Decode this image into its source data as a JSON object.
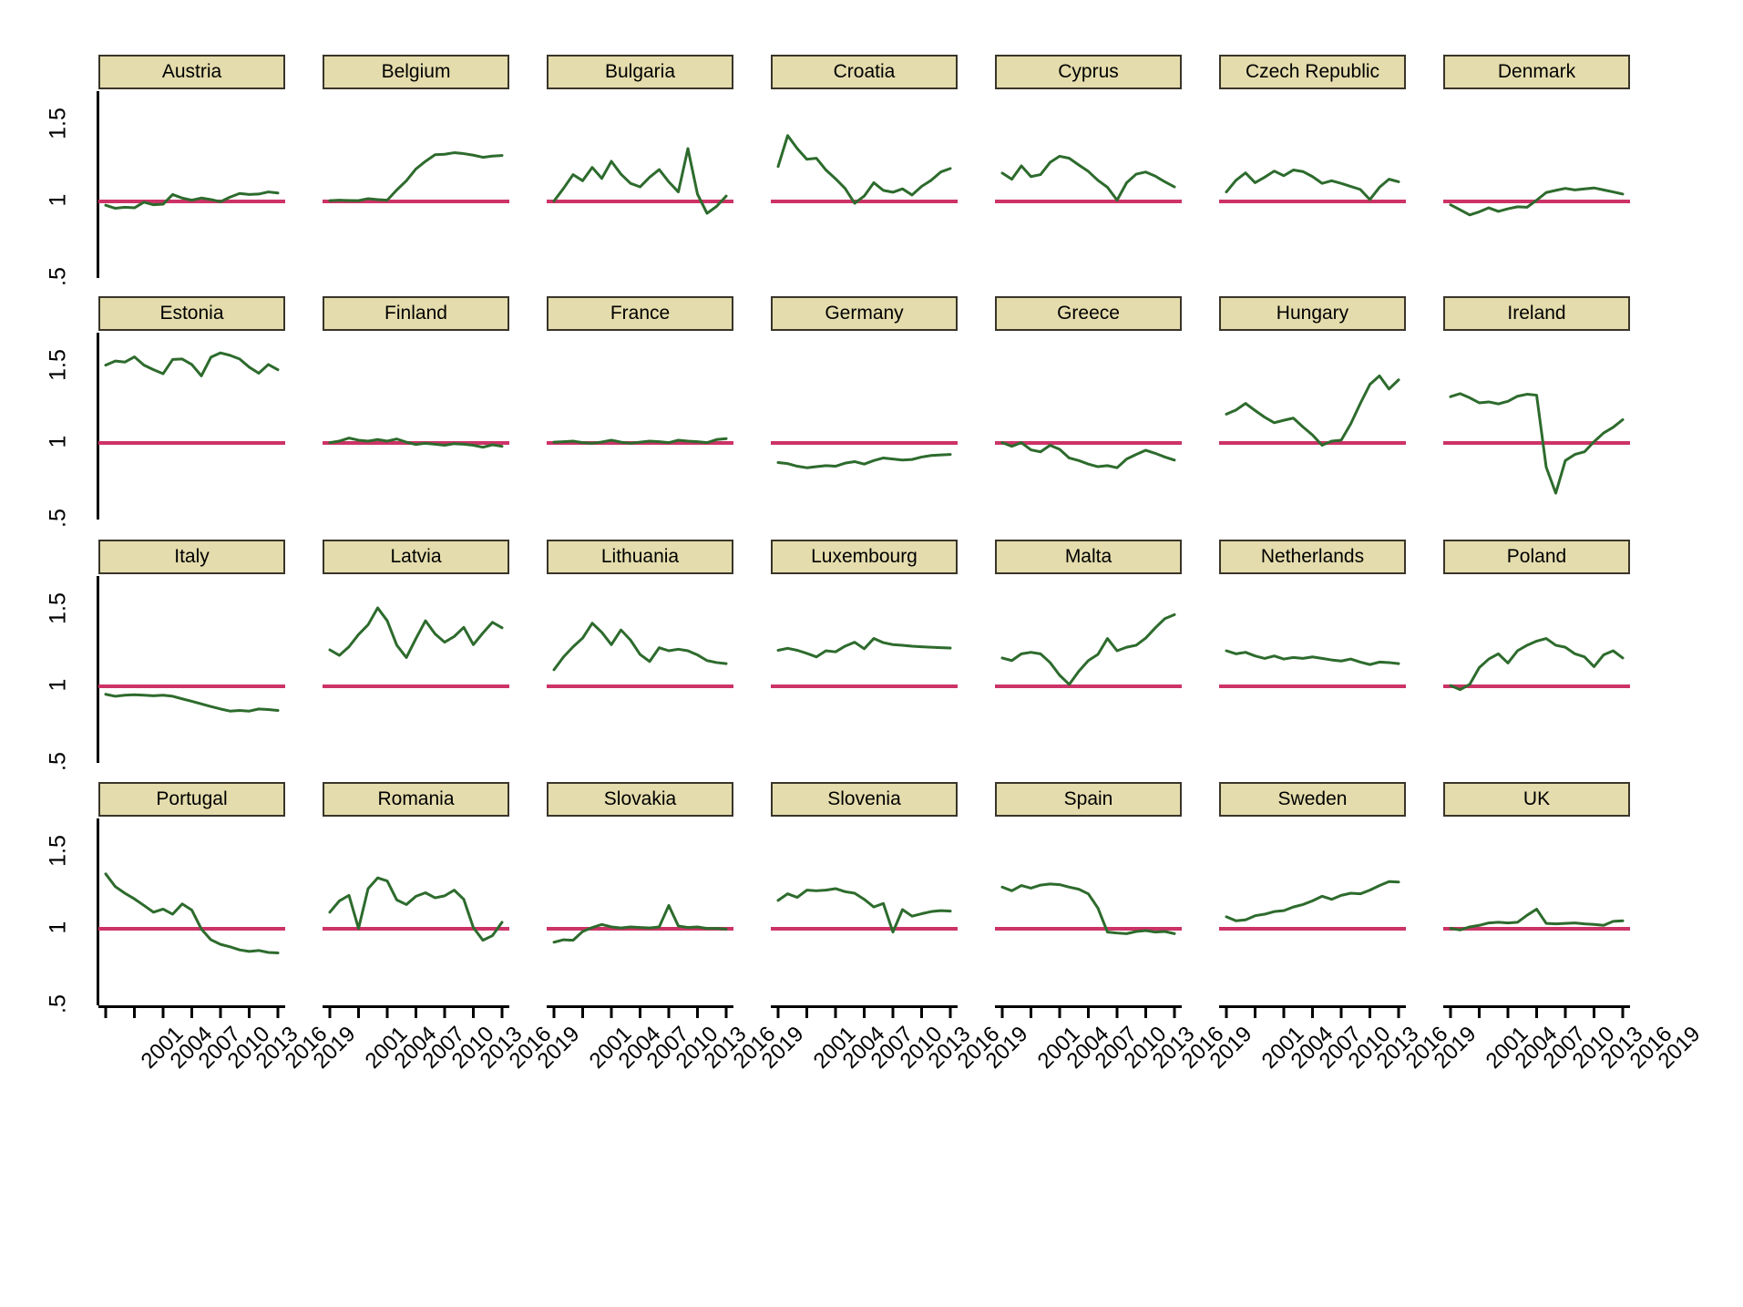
{
  "chart_data": {
    "type": "line",
    "title": "",
    "subtitle": "",
    "xlabel": "",
    "ylabel": "",
    "grid": false,
    "legend_position": "none",
    "layout": {
      "rows": 4,
      "cols": 7,
      "panels": 28
    },
    "x": [
      2001,
      2002,
      2003,
      2004,
      2005,
      2006,
      2007,
      2008,
      2009,
      2010,
      2011,
      2012,
      2013,
      2014,
      2015,
      2016,
      2017,
      2018,
      2019
    ],
    "xlim": [
      2001,
      2019
    ],
    "ylim": [
      0.5,
      1.72
    ],
    "xticks": [
      2001,
      2004,
      2007,
      2010,
      2013,
      2016,
      2019
    ],
    "xtick_labels": [
      "2001",
      "2004",
      "2007",
      "2010",
      "2013",
      "2016",
      "2019"
    ],
    "yticks": [
      0.5,
      1.0,
      1.5
    ],
    "ytick_labels": [
      ".5",
      "1",
      "1.5"
    ],
    "reference_line": {
      "value": 1.0,
      "color": "#cc3366",
      "width": 4
    },
    "series_color": "#2d6b2d",
    "series_width": 3,
    "panels": [
      {
        "name": "Austria",
        "row": 0,
        "col": 0,
        "values": [
          0.975,
          0.955,
          0.962,
          0.958,
          0.995,
          0.978,
          0.982,
          1.045,
          1.022,
          1.008,
          1.022,
          1.012,
          0.998,
          1.028,
          1.052,
          1.045,
          1.048,
          1.062,
          1.055
        ]
      },
      {
        "name": "Belgium",
        "row": 0,
        "col": 1,
        "values": [
          1.005,
          1.008,
          1.006,
          1.005,
          1.018,
          1.012,
          1.008,
          1.075,
          1.135,
          1.212,
          1.262,
          1.305,
          1.308,
          1.318,
          1.312,
          1.302,
          1.288,
          1.296,
          1.3
        ]
      },
      {
        "name": "Bulgaria",
        "row": 0,
        "col": 2,
        "values": [
          1.002,
          1.085,
          1.175,
          1.135,
          1.222,
          1.15,
          1.262,
          1.178,
          1.118,
          1.095,
          1.158,
          1.208,
          1.128,
          1.062,
          1.345,
          1.048,
          0.922,
          0.968,
          1.035
        ]
      },
      {
        "name": "Croatia",
        "row": 0,
        "col": 3,
        "values": [
          1.228,
          1.43,
          1.345,
          1.275,
          1.282,
          1.205,
          1.148,
          1.085,
          0.988,
          1.035,
          1.122,
          1.072,
          1.06,
          1.082,
          1.042,
          1.098,
          1.138,
          1.192,
          1.215
        ]
      },
      {
        "name": "Cyprus",
        "row": 0,
        "col": 4,
        "values": [
          1.185,
          1.145,
          1.232,
          1.162,
          1.175,
          1.255,
          1.295,
          1.282,
          1.238,
          1.196,
          1.138,
          1.092,
          1.008,
          1.122,
          1.178,
          1.192,
          1.165,
          1.128,
          1.095
        ]
      },
      {
        "name": "Czech Republic",
        "row": 0,
        "col": 5,
        "values": [
          1.062,
          1.138,
          1.186,
          1.122,
          1.158,
          1.198,
          1.168,
          1.205,
          1.195,
          1.162,
          1.118,
          1.135,
          1.118,
          1.098,
          1.078,
          1.012,
          1.092,
          1.145,
          1.128
        ]
      },
      {
        "name": "Denmark",
        "row": 0,
        "col": 6,
        "values": [
          0.978,
          0.945,
          0.912,
          0.932,
          0.958,
          0.935,
          0.952,
          0.965,
          0.962,
          1.008,
          1.058,
          1.072,
          1.085,
          1.075,
          1.082,
          1.088,
          1.075,
          1.062,
          1.048
        ]
      },
      {
        "name": "Estonia",
        "row": 1,
        "col": 0,
        "values": [
          1.508,
          1.535,
          1.528,
          1.562,
          1.508,
          1.478,
          1.452,
          1.545,
          1.548,
          1.512,
          1.438,
          1.56,
          1.588,
          1.572,
          1.548,
          1.495,
          1.455,
          1.512,
          1.478
        ]
      },
      {
        "name": "Finland",
        "row": 1,
        "col": 1,
        "values": [
          1.002,
          1.012,
          1.032,
          1.018,
          1.012,
          1.022,
          1.012,
          1.026,
          1.005,
          0.99,
          0.998,
          0.992,
          0.985,
          0.995,
          0.992,
          0.985,
          0.972,
          0.988,
          0.978
        ]
      },
      {
        "name": "France",
        "row": 1,
        "col": 2,
        "values": [
          1.005,
          1.008,
          1.012,
          1.002,
          0.998,
          1.006,
          1.018,
          1.005,
          0.998,
          1.005,
          1.012,
          1.008,
          1.002,
          1.018,
          1.012,
          1.008,
          1.002,
          1.022,
          1.028
        ]
      },
      {
        "name": "Germany",
        "row": 1,
        "col": 3,
        "values": [
          0.872,
          0.865,
          0.848,
          0.838,
          0.845,
          0.852,
          0.848,
          0.868,
          0.878,
          0.862,
          0.885,
          0.902,
          0.895,
          0.888,
          0.892,
          0.908,
          0.918,
          0.922,
          0.925
        ]
      },
      {
        "name": "Greece",
        "row": 1,
        "col": 4,
        "values": [
          1.002,
          0.978,
          1.002,
          0.955,
          0.942,
          0.985,
          0.958,
          0.902,
          0.885,
          0.862,
          0.845,
          0.852,
          0.838,
          0.895,
          0.925,
          0.952,
          0.932,
          0.908,
          0.888
        ]
      },
      {
        "name": "Hungary",
        "row": 1,
        "col": 5,
        "values": [
          1.188,
          1.215,
          1.258,
          1.212,
          1.168,
          1.132,
          1.148,
          1.162,
          1.105,
          1.052,
          0.985,
          1.012,
          1.018,
          1.125,
          1.258,
          1.382,
          1.438,
          1.352,
          1.412
        ]
      },
      {
        "name": "Ireland",
        "row": 1,
        "col": 6,
        "values": [
          1.302,
          1.322,
          1.295,
          1.262,
          1.268,
          1.255,
          1.272,
          1.305,
          1.318,
          1.312,
          0.842,
          0.672,
          0.885,
          0.925,
          0.942,
          1.008,
          1.065,
          1.102,
          1.152
        ]
      },
      {
        "name": "Italy",
        "row": 2,
        "col": 0,
        "values": [
          0.948,
          0.935,
          0.942,
          0.945,
          0.942,
          0.938,
          0.942,
          0.935,
          0.918,
          0.902,
          0.885,
          0.868,
          0.852,
          0.838,
          0.842,
          0.838,
          0.852,
          0.848,
          0.842
        ]
      },
      {
        "name": "Latvia",
        "row": 2,
        "col": 1,
        "values": [
          1.238,
          1.202,
          1.258,
          1.338,
          1.402,
          1.512,
          1.428,
          1.268,
          1.188,
          1.312,
          1.428,
          1.342,
          1.288,
          1.325,
          1.385,
          1.272,
          1.348,
          1.418,
          1.382
        ]
      },
      {
        "name": "Lithuania",
        "row": 2,
        "col": 2,
        "values": [
          1.108,
          1.192,
          1.258,
          1.315,
          1.412,
          1.352,
          1.272,
          1.368,
          1.302,
          1.208,
          1.162,
          1.252,
          1.232,
          1.242,
          1.232,
          1.205,
          1.168,
          1.155,
          1.148
        ]
      },
      {
        "name": "Luxembourg",
        "row": 2,
        "col": 3,
        "values": [
          1.235,
          1.248,
          1.235,
          1.215,
          1.192,
          1.232,
          1.225,
          1.262,
          1.288,
          1.245,
          1.312,
          1.285,
          1.272,
          1.268,
          1.262,
          1.258,
          1.255,
          1.252,
          1.25
        ]
      },
      {
        "name": "Malta",
        "row": 2,
        "col": 4,
        "values": [
          1.185,
          1.168,
          1.212,
          1.222,
          1.212,
          1.155,
          1.072,
          1.012,
          1.098,
          1.168,
          1.208,
          1.312,
          1.232,
          1.255,
          1.268,
          1.315,
          1.382,
          1.442,
          1.468
        ]
      },
      {
        "name": "Netherlands",
        "row": 2,
        "col": 5,
        "values": [
          1.232,
          1.212,
          1.222,
          1.198,
          1.182,
          1.198,
          1.178,
          1.188,
          1.182,
          1.192,
          1.182,
          1.172,
          1.165,
          1.178,
          1.158,
          1.142,
          1.158,
          1.155,
          1.148
        ]
      },
      {
        "name": "Poland",
        "row": 2,
        "col": 6,
        "values": [
          1.005,
          0.978,
          1.012,
          1.122,
          1.178,
          1.212,
          1.152,
          1.232,
          1.268,
          1.295,
          1.312,
          1.268,
          1.255,
          1.212,
          1.192,
          1.128,
          1.205,
          1.232,
          1.185
        ]
      },
      {
        "name": "Portugal",
        "row": 3,
        "col": 0,
        "values": [
          1.358,
          1.275,
          1.232,
          1.195,
          1.152,
          1.108,
          1.128,
          1.095,
          1.162,
          1.122,
          0.998,
          0.928,
          0.898,
          0.882,
          0.862,
          0.852,
          0.858,
          0.845,
          0.842
        ]
      },
      {
        "name": "Romania",
        "row": 3,
        "col": 1,
        "values": [
          1.108,
          1.182,
          1.218,
          1.002,
          1.262,
          1.332,
          1.312,
          1.188,
          1.158,
          1.212,
          1.235,
          1.202,
          1.215,
          1.252,
          1.192,
          1.008,
          0.925,
          0.955,
          1.042
        ]
      },
      {
        "name": "Slovakia",
        "row": 3,
        "col": 2,
        "values": [
          0.912,
          0.928,
          0.925,
          0.982,
          1.008,
          1.028,
          1.012,
          1.005,
          1.012,
          1.008,
          1.005,
          1.012,
          1.152,
          1.018,
          1.008,
          1.012,
          1.002,
          1.002,
          0.998
        ]
      },
      {
        "name": "Slovenia",
        "row": 3,
        "col": 3,
        "values": [
          1.185,
          1.228,
          1.205,
          1.252,
          1.248,
          1.252,
          1.262,
          1.242,
          1.232,
          1.192,
          1.142,
          1.165,
          0.978,
          1.125,
          1.082,
          1.098,
          1.112,
          1.118,
          1.115
        ]
      },
      {
        "name": "Spain",
        "row": 3,
        "col": 4,
        "values": [
          1.272,
          1.248,
          1.282,
          1.265,
          1.285,
          1.292,
          1.288,
          1.272,
          1.258,
          1.228,
          1.135,
          0.978,
          0.972,
          0.968,
          0.982,
          0.988,
          0.978,
          0.982,
          0.968
        ]
      },
      {
        "name": "Sweden",
        "row": 3,
        "col": 5,
        "values": [
          1.078,
          1.052,
          1.058,
          1.085,
          1.095,
          1.112,
          1.118,
          1.142,
          1.158,
          1.182,
          1.212,
          1.192,
          1.218,
          1.232,
          1.228,
          1.252,
          1.282,
          1.308,
          1.305
        ]
      },
      {
        "name": "UK",
        "row": 3,
        "col": 6,
        "values": [
          1.002,
          0.992,
          1.012,
          1.022,
          1.038,
          1.042,
          1.038,
          1.042,
          1.088,
          1.128,
          1.035,
          1.032,
          1.035,
          1.038,
          1.032,
          1.028,
          1.022,
          1.048,
          1.052
        ]
      }
    ]
  }
}
